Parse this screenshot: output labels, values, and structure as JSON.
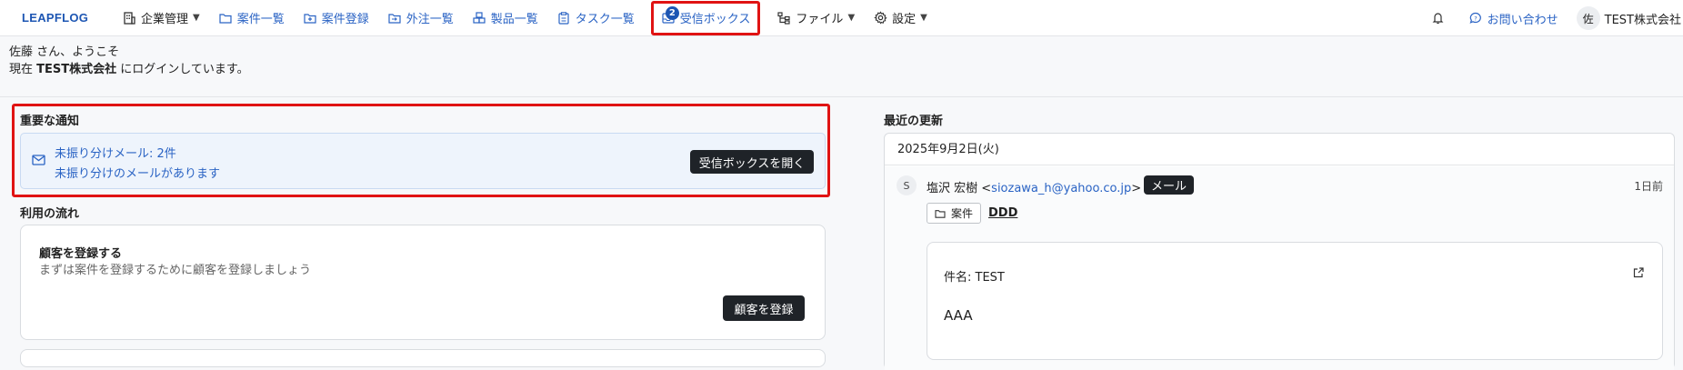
{
  "brand": "LEAPFLOG",
  "nav": {
    "company": "企業管理",
    "cases": "案件一覧",
    "case_register": "案件登録",
    "outsource": "外注一覧",
    "products": "製品一覧",
    "tasks": "タスク一覧",
    "inbox": "受信ボックス",
    "inbox_badge": "2",
    "files": "ファイル",
    "settings": "設定"
  },
  "right_nav": {
    "contact": "お問い合わせ",
    "avatar_initial": "佐",
    "company_name": "TEST株式会社"
  },
  "welcome": {
    "line1": "佐藤 さん、ようこそ",
    "line2_prefix": "現在 ",
    "line2_company": "TEST株式会社",
    "line2_suffix": " にログインしています。"
  },
  "notices": {
    "title": "重要な通知",
    "line1": "未振り分けメール: 2件",
    "line2": "未振り分けのメールがあります",
    "button": "受信ボックスを開く"
  },
  "flow": {
    "title": "利用の流れ",
    "step1_title": "顧客を登録する",
    "step1_desc": "まずは案件を登録するために顧客を登録しましょう",
    "step1_button": "顧客を登録"
  },
  "updates": {
    "title": "最近の更新",
    "date": "2025年9月2日(火)",
    "avatar_initial": "S",
    "sender_name": "塩沢 宏樹 <",
    "sender_email": "siozawa_h@yahoo.co.jp",
    "sender_close": ">",
    "type_tag": "メール",
    "ago": "1日前",
    "case_tag": "案件",
    "case_name": "DDD",
    "subject": "件名: TEST",
    "body": "AAA"
  },
  "colors": {
    "accent": "#2a63c4",
    "highlight": "#e01313",
    "dark_button": "#1f2328"
  }
}
